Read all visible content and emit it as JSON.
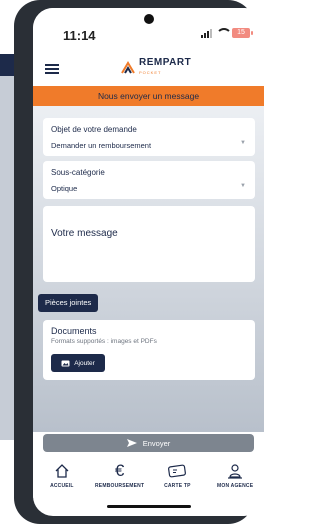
{
  "status": {
    "time": "11:14",
    "battery": "15"
  },
  "header": {
    "logo_main": "REMPART",
    "logo_sub": "POCKET"
  },
  "banner": {
    "title": "Nous envoyer un message"
  },
  "form": {
    "object": {
      "label": "Objet de votre demande",
      "value": "Demander un remboursement"
    },
    "subcategory": {
      "label": "Sous-catégorie",
      "value": "Optique"
    },
    "message": {
      "placeholder": "Votre message"
    }
  },
  "attachments": {
    "tag": "Pièces jointes",
    "documents_title": "Documents",
    "documents_sub": "Formats supportés : images et PDFs",
    "add_label": "Ajouter"
  },
  "send": {
    "label": "Envoyer"
  },
  "nav": [
    {
      "label": "ACCUEIL",
      "icon": "home-icon"
    },
    {
      "label": "REMBOURSEMENT",
      "icon": "euro-icon"
    },
    {
      "label": "CARTE TP",
      "icon": "card-icon"
    },
    {
      "label": "MON AGENCE",
      "icon": "agency-icon"
    }
  ],
  "colors": {
    "navy": "#1d2a4a",
    "orange": "#f07b2a",
    "disabled": "#7d858f"
  }
}
